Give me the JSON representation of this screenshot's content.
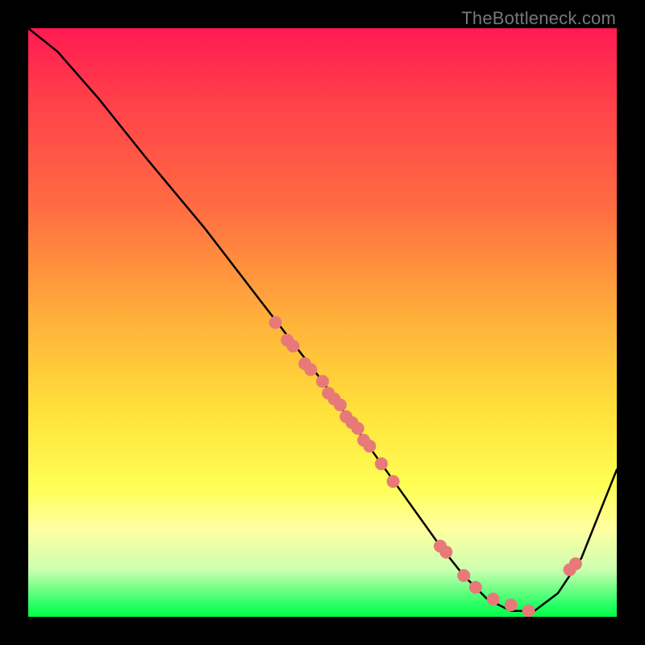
{
  "watermark": "TheBottleneck.com",
  "chart_data": {
    "type": "line",
    "title": "",
    "xlabel": "",
    "ylabel": "",
    "xlim": [
      0,
      100
    ],
    "ylim": [
      0,
      100
    ],
    "curve": {
      "x": [
        0,
        5,
        12,
        20,
        30,
        40,
        50,
        55,
        60,
        65,
        70,
        74,
        78,
        82,
        86,
        90,
        94,
        100
      ],
      "y": [
        100,
        96,
        88,
        78,
        66,
        53,
        40,
        33,
        26,
        19,
        12,
        7,
        3,
        1,
        1,
        4,
        10,
        25
      ]
    },
    "markers": {
      "x": [
        42,
        44,
        45,
        47,
        48,
        50,
        51,
        52,
        53,
        54,
        55,
        56,
        57,
        58,
        60,
        62,
        70,
        71,
        74,
        76,
        79,
        82,
        85,
        92,
        93
      ],
      "y": [
        50,
        47,
        46,
        43,
        42,
        40,
        38,
        37,
        36,
        34,
        33,
        32,
        30,
        29,
        26,
        23,
        12,
        11,
        7,
        5,
        3,
        2,
        1,
        8,
        9
      ]
    },
    "marker_style": {
      "color": "#e77a78",
      "radius_px": 8
    },
    "gradient_stops": [
      {
        "pos": 0,
        "color": "#ff1a52"
      },
      {
        "pos": 30,
        "color": "#ff6b42"
      },
      {
        "pos": 65,
        "color": "#ffe13a"
      },
      {
        "pos": 92,
        "color": "#ccffb0"
      },
      {
        "pos": 100,
        "color": "#00ff46"
      }
    ]
  }
}
